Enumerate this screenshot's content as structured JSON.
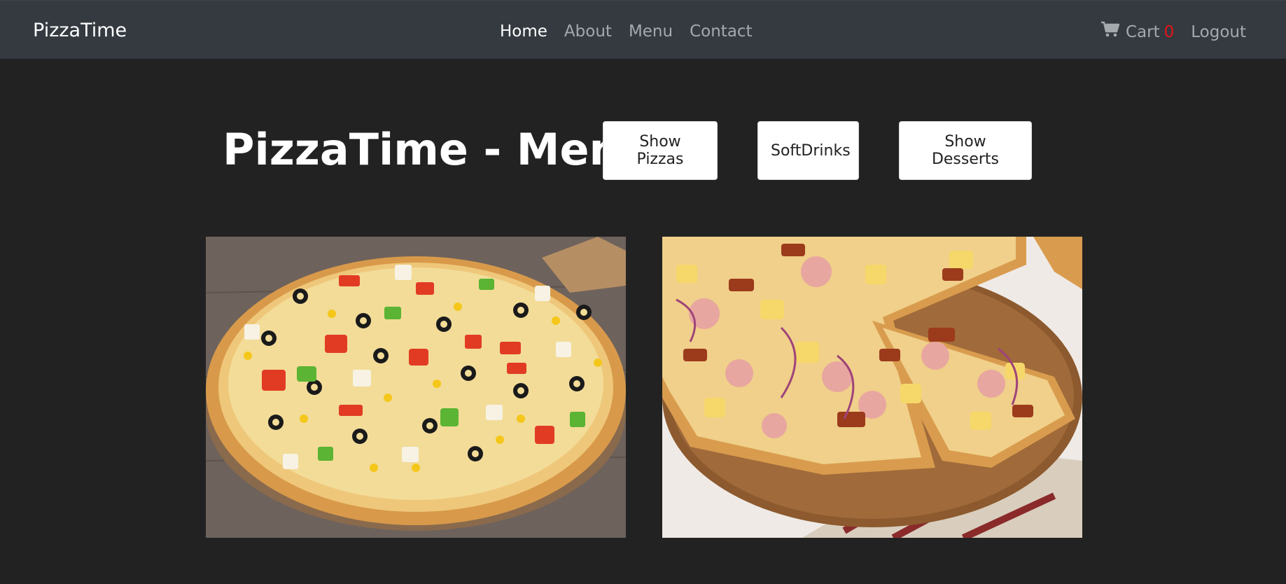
{
  "navbar": {
    "brand": "PizzaTime",
    "links": [
      {
        "label": "Home",
        "active": true
      },
      {
        "label": "About",
        "active": false
      },
      {
        "label": "Menu",
        "active": false
      },
      {
        "label": "Contact",
        "active": false
      }
    ],
    "cart": {
      "label": "Cart",
      "count": "0",
      "icon": "shopping-cart-icon"
    },
    "logout_label": "Logout"
  },
  "header": {
    "title": "PizzaTime - Menu",
    "buttons": {
      "pizzas": "Show Pizzas",
      "drinks": "SoftDrinks",
      "desserts": "Show Desserts"
    }
  },
  "products": [
    {
      "image": "vegetable-pizza-photo"
    },
    {
      "image": "hawaiian-pizza-photo"
    }
  ],
  "colors": {
    "page_bg": "#222222",
    "navbar_bg": "#343a40",
    "cart_count": "#e3151a"
  }
}
